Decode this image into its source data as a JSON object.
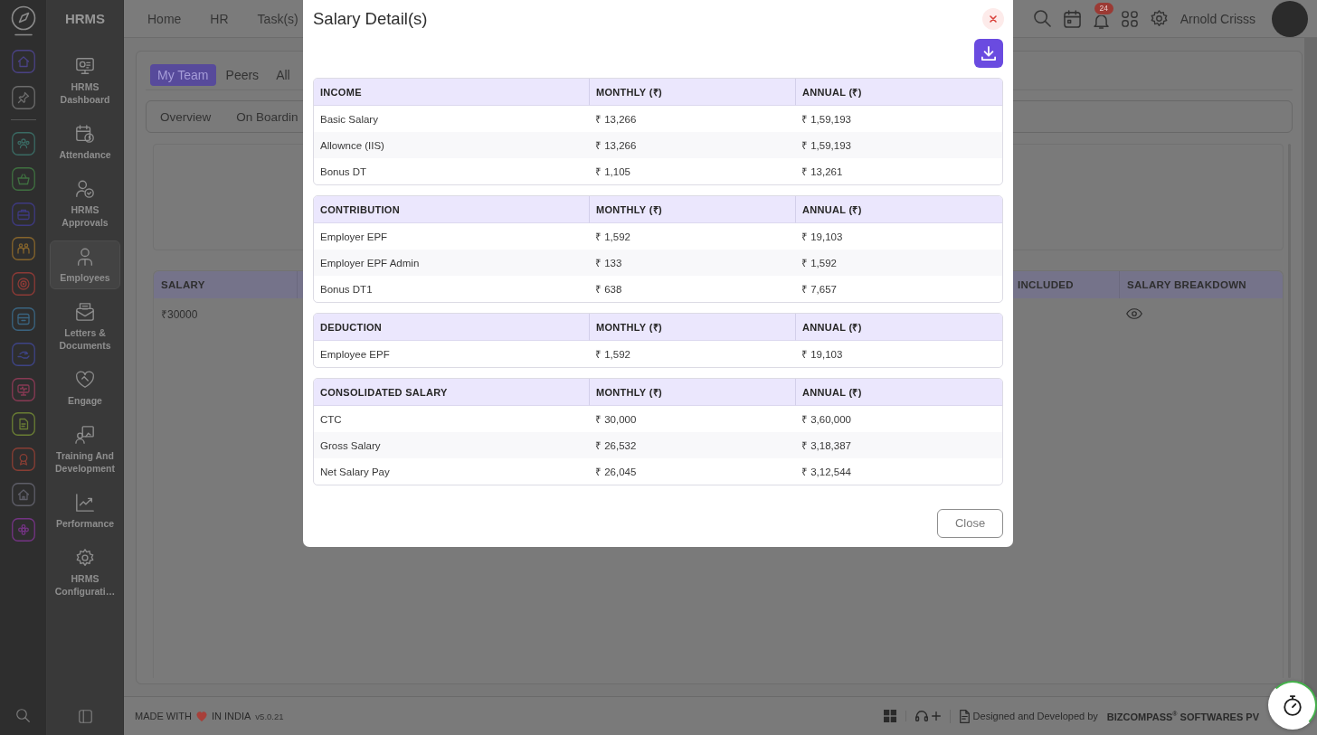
{
  "icon_rail": {
    "pinned": [
      {
        "color": "#4a4285"
      },
      {
        "color": "#6c6c6c"
      }
    ],
    "apps": [
      {
        "color": "#3a6a63"
      },
      {
        "color": "#3f7040"
      },
      {
        "color": "#3e3a80"
      },
      {
        "color": "#85642c"
      },
      {
        "color": "#8c3a36"
      },
      {
        "color": "#3a6480"
      },
      {
        "color": "#3e4486"
      },
      {
        "color": "#883a54"
      },
      {
        "color": "#6a7e34"
      },
      {
        "color": "#883e34"
      },
      {
        "color": "#5e5e68"
      },
      {
        "color": "#743484"
      }
    ]
  },
  "sidebar": {
    "title": "HRMS",
    "items": [
      {
        "label": "HRMS Dashboard",
        "selected": false
      },
      {
        "label": "Attendance",
        "selected": false
      },
      {
        "label": "HRMS Approvals",
        "selected": false
      },
      {
        "label": "Employees",
        "selected": true
      },
      {
        "label": "Letters & Documents",
        "selected": false
      },
      {
        "label": "Engage",
        "selected": false
      },
      {
        "label": "Training And Development",
        "selected": false
      },
      {
        "label": "Performance",
        "selected": false
      },
      {
        "label": "HRMS Configurati…",
        "selected": false
      }
    ]
  },
  "top_bar": {
    "nav": [
      "Home",
      "HR",
      "Task(s)"
    ],
    "notification_count": "24",
    "user_name": "Arnold Crisss"
  },
  "employees_page": {
    "team_tabs": [
      {
        "label": "My Team",
        "selected": true
      },
      {
        "label": "Peers",
        "selected": false
      },
      {
        "label": "All",
        "selected": false
      }
    ],
    "section_tabs": [
      "Overview",
      "On Boardin"
    ],
    "salary_table": {
      "columns": [
        "SALARY",
        "INCLUDED",
        "SALARY BREAKDOWN"
      ],
      "rows": [
        {
          "salary": "₹30000"
        }
      ]
    }
  },
  "footer": {
    "made_with": "MADE WITH",
    "country": "IN INDIA",
    "version": "v5.0.21",
    "credit": "Designed and Developed by",
    "company": "BIZCOMPASS$^{®}$ SOFTWARES PV"
  },
  "salary_modal": {
    "title": "Salary Detail(s)",
    "sections": [
      {
        "columns": [
          "INCOME",
          "MONTHLY (₹)",
          "ANNUAL (₹)"
        ],
        "rows": [
          [
            "Basic Salary",
            "₹ 13,266",
            "₹ 1,59,193"
          ],
          [
            "Allownce (IIS)",
            "₹ 13,266",
            "₹ 1,59,193"
          ],
          [
            "Bonus DT",
            "₹ 1,105",
            "₹ 13,261"
          ]
        ]
      },
      {
        "columns": [
          "CONTRIBUTION",
          "MONTHLY (₹)",
          "ANNUAL (₹)"
        ],
        "rows": [
          [
            "Employer EPF",
            "₹ 1,592",
            "₹ 19,103"
          ],
          [
            "Employer EPF Admin",
            "₹ 133",
            "₹ 1,592"
          ],
          [
            "Bonus DT1",
            "₹ 638",
            "₹ 7,657"
          ]
        ]
      },
      {
        "columns": [
          "DEDUCTION",
          "MONTHLY (₹)",
          "ANNUAL (₹)"
        ],
        "rows": [
          [
            "Employee EPF",
            "₹ 1,592",
            "₹ 19,103"
          ]
        ]
      },
      {
        "columns": [
          "CONSOLIDATED SALARY",
          "MONTHLY (₹)",
          "ANNUAL (₹)"
        ],
        "rows": [
          [
            "CTC",
            "₹ 30,000",
            "₹ 3,60,000"
          ],
          [
            "Gross Salary",
            "₹ 26,532",
            "₹ 3,18,387"
          ],
          [
            "Net Salary Pay",
            "₹ 26,045",
            "₹ 3,12,544"
          ]
        ]
      }
    ],
    "close_label": "Close"
  }
}
